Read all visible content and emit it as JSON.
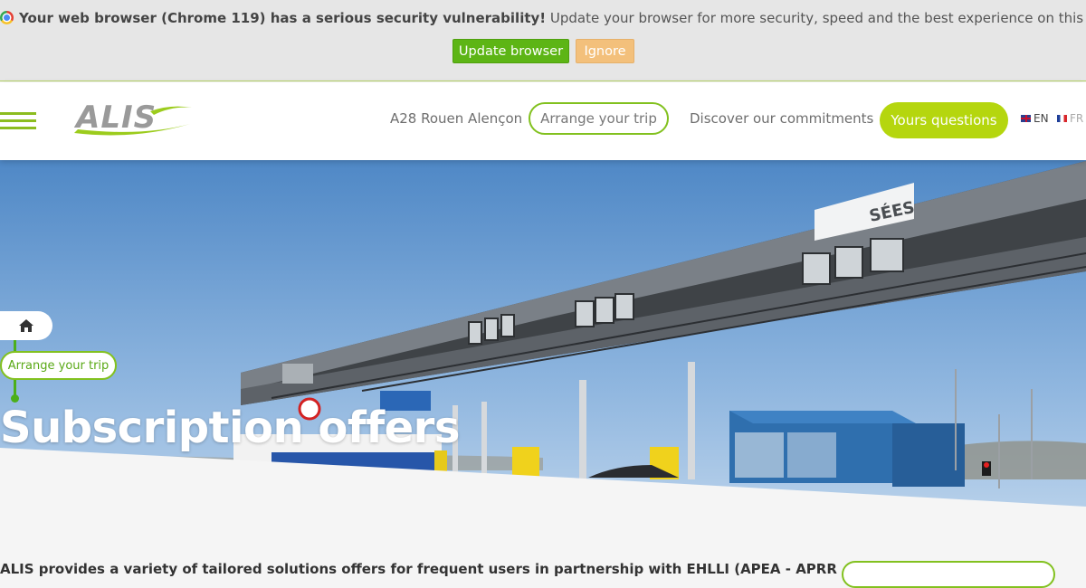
{
  "banner": {
    "bold_text": "Your web browser (Chrome 119) has a serious security vulnerability!",
    "text": " Update your browser for more security, speed and the best experience on this site.",
    "update_label": "Update browser",
    "ignore_label": "Ignore"
  },
  "header": {
    "logo_text": "ALIS",
    "nav": {
      "route_label": "A28 Rouen Alençon",
      "trip_label": "Arrange your trip",
      "commitments_label": "Discover our commitments",
      "questions_label": "Yours questions"
    },
    "languages": {
      "en": "EN",
      "fr": "FR"
    }
  },
  "hero": {
    "toll_sign": "SÉES",
    "breadcrumb": {
      "current": "Arrange your trip"
    },
    "title": "Subscription offers"
  },
  "content": {
    "intro_partial": "ALIS provides a variety of tailored solutions offers for frequent users in partnership with EHLLI (APEA - APRR"
  },
  "colors": {
    "accent_green": "#82c11f",
    "pill_lime": "#b5d60e",
    "update_green": "#5db515",
    "ignore_orange": "#f3c07b"
  }
}
